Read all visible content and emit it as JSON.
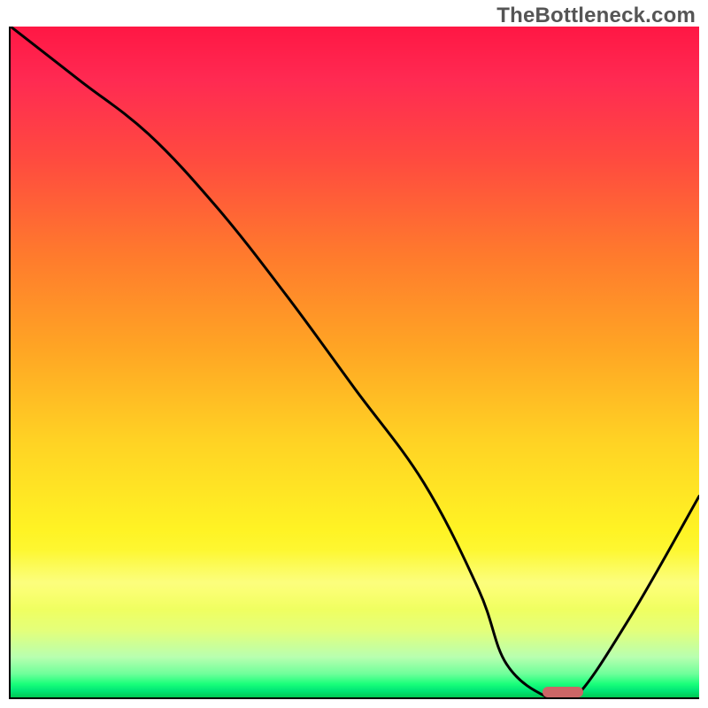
{
  "watermark": "TheBottleneck.com",
  "colors": {
    "axis": "#000000",
    "curve": "#000000",
    "marker": "#cc6666",
    "gradient_top": "#ff1744",
    "gradient_mid": "#fff324",
    "gradient_bottom": "#00c853"
  },
  "chart_data": {
    "type": "line",
    "title": "",
    "xlabel": "",
    "ylabel": "",
    "xlim": [
      0,
      100
    ],
    "ylim": [
      0,
      100
    ],
    "grid": false,
    "legend": false,
    "x": [
      0,
      10,
      20,
      30,
      40,
      50,
      60,
      68,
      72,
      78,
      82,
      90,
      100
    ],
    "values": [
      100,
      92,
      84,
      73,
      60,
      46,
      32,
      16,
      5,
      0,
      0,
      12,
      30
    ],
    "marker": {
      "x_start": 77,
      "x_end": 83,
      "y": 0,
      "thickness": 1.6
    },
    "annotations": []
  }
}
